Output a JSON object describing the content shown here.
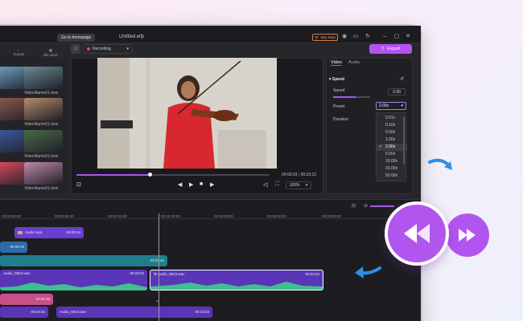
{
  "window": {
    "file_title": "Untitled.wfp",
    "tooltip": "Go to homepage",
    "buy_now": "Buy Now"
  },
  "toolbar": {
    "recording_label": "Recording",
    "export_label": "Export"
  },
  "media": {
    "tabs": [
      "Sound",
      "Sfx store"
    ],
    "thumbnails": [
      {
        "label": "",
        "color": "#6b9cc0"
      },
      {
        "label": "VideoName01.mov",
        "color": "#6a8a92"
      },
      {
        "label": "",
        "color": "#8a5a4a"
      },
      {
        "label": "VideoName01.mov",
        "color": "#b58a6a"
      },
      {
        "label": "",
        "color": "#3a5a9a"
      },
      {
        "label": "VideoName01.mov",
        "color": "#4a6a44"
      },
      {
        "label": "",
        "color": "#d94a5a"
      },
      {
        "label": "VideoName01.mov",
        "color": "#c08aa8"
      },
      {
        "label": "",
        "color": "#5a4a8a"
      },
      {
        "label": "VideoName01.mov",
        "color": "#b8a8d8"
      }
    ]
  },
  "preview": {
    "current_time": "00:00:23",
    "total_time": "00:23:12",
    "progress": 0.38,
    "zoom": "100%"
  },
  "properties": {
    "tabs": [
      "Video",
      "Audio"
    ],
    "section": "Speed",
    "speed_label": "Speed",
    "speed_value": "2.00",
    "speed_fraction": 0.6,
    "preset_label": "Preset",
    "preset_value": "2.00x",
    "duration_label": "Duration",
    "preset_options": [
      "0.01x",
      "0.10x",
      "0.50x",
      "1.00x",
      "2.00x",
      "5.00x",
      "10.00x",
      "20.00x",
      "50.00x"
    ],
    "preset_selected": "2.00x"
  },
  "timeline": {
    "ruler": [
      "00:00:00:00",
      "00:00:00:00",
      "00:00:00:00",
      "00:00:00:00",
      "00:00:00:00",
      "00:00:00:00",
      "00:00:00:00"
    ],
    "clips": {
      "audio_cover": {
        "name": "Audio.cara",
        "dur": "00:00:44"
      },
      "short1_dur": "00:00:48",
      "long_dur": "00:00:48",
      "audio_a": {
        "name": "Audio_0823.wav",
        "dur": "00:23:34"
      },
      "audio_b": {
        "name": "Audio_0823.wav",
        "dur": "00:23:34"
      },
      "pink_dur": "00:00:48",
      "audio_c_dur": "00:23:34",
      "audio_d": {
        "name": "Audio_0823.wav",
        "dur": "00:23:34"
      }
    }
  },
  "colors": {
    "accent": "#b253f0",
    "arrow_blue": "#2e8fe6"
  }
}
